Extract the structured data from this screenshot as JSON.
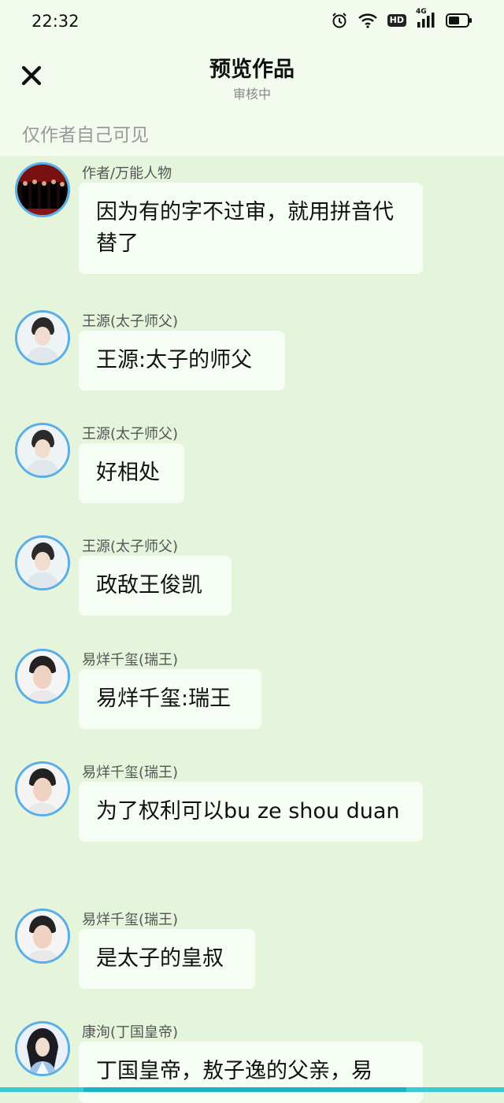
{
  "status_bar": {
    "time": "22:32",
    "icons": [
      "alarm-icon",
      "wifi-icon",
      "hd-icon",
      "signal-4g-icon",
      "battery-icon"
    ],
    "hd_label": "HD",
    "network_label": "4G"
  },
  "header": {
    "title": "预览作品",
    "subtitle": "审核中",
    "visibility_note": "仅作者自己可见"
  },
  "messages": [
    {
      "speaker": "作者/万能人物",
      "text": "因为有的字不过审，就用拼音代替了",
      "avatar": "author-avatar"
    },
    {
      "speaker": "王源(太子师父)",
      "text": "王源:太子的师父",
      "avatar": "wangyuan-avatar"
    },
    {
      "speaker": "王源(太子师父)",
      "text": "好相处",
      "avatar": "wangyuan-avatar"
    },
    {
      "speaker": "王源(太子师父)",
      "text": "政敌王俊凯",
      "avatar": "wangyuan-avatar"
    },
    {
      "speaker": "易烊千玺(瑞王)",
      "text": "易烊千玺:瑞王",
      "avatar": "yiyang-avatar"
    },
    {
      "speaker": "易烊千玺(瑞王)",
      "text": "为了权利可以bu ze shou duan",
      "avatar": "yiyang-avatar"
    },
    {
      "speaker": "易烊千玺(瑞王)",
      "text": "是太子的皇叔",
      "avatar": "yiyang-avatar"
    },
    {
      "speaker": "康洵(丁国皇帝)",
      "text": "丁国皇帝，敖子逸的父亲，易",
      "avatar": "emperor-avatar"
    }
  ],
  "colors": {
    "background": "#e5f5dc",
    "header_bg": "#f3fbee",
    "bubble_bg": "#f6fdf4",
    "avatar_ring": "#5aaee8",
    "bottom_bar": "#3cc9d9"
  }
}
